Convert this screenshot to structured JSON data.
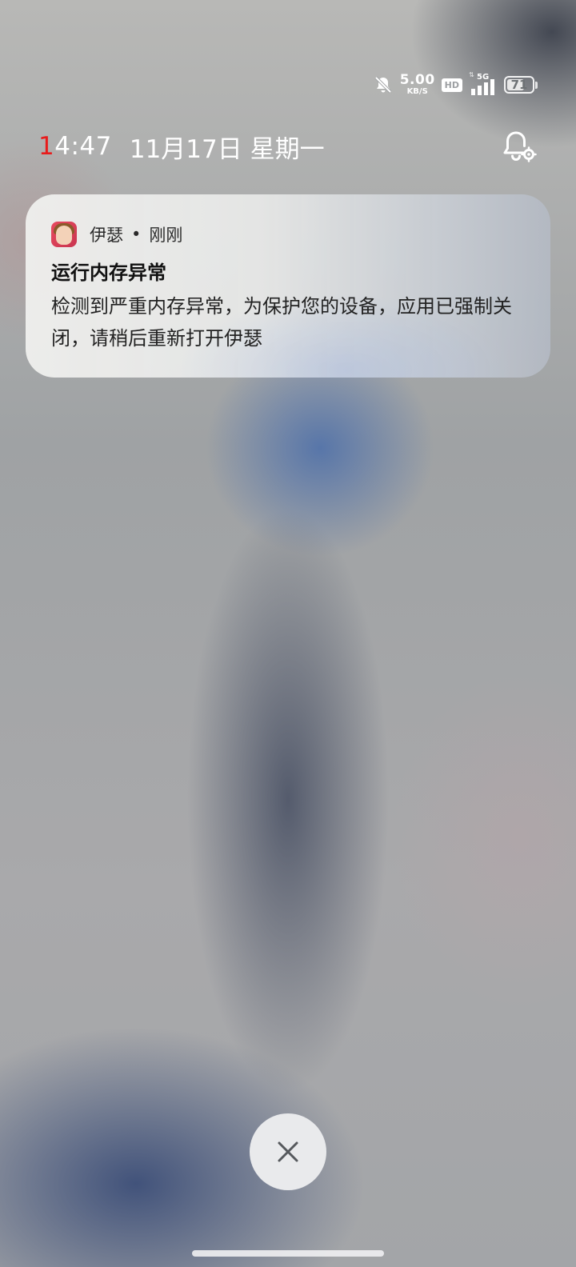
{
  "status_bar": {
    "net_speed_value": "5.00",
    "net_speed_unit": "KB/S",
    "hd_label": "HD",
    "network_type": "5G",
    "battery_level": "71",
    "battery_fraction": 0.71,
    "icons": [
      "bell-muted-icon",
      "signal-icon",
      "battery-icon"
    ]
  },
  "header": {
    "time_first_digit": "1",
    "time_rest": "4:47",
    "date": "11月17日 星期一",
    "settings_icon": "bell-settings-icon"
  },
  "notification": {
    "app_name": "伊瑟",
    "separator": "•",
    "time_ago": "刚刚",
    "title": "运行内存异常",
    "body": "检测到严重内存异常，为保护您的设备，应用已强制关闭，请稍后重新打开伊瑟"
  },
  "controls": {
    "clear_icon": "close-icon"
  },
  "colors": {
    "time_accent": "#e81b1b",
    "card_text": "#1c1c1c",
    "clear_button_bg": "#e9eaec"
  }
}
